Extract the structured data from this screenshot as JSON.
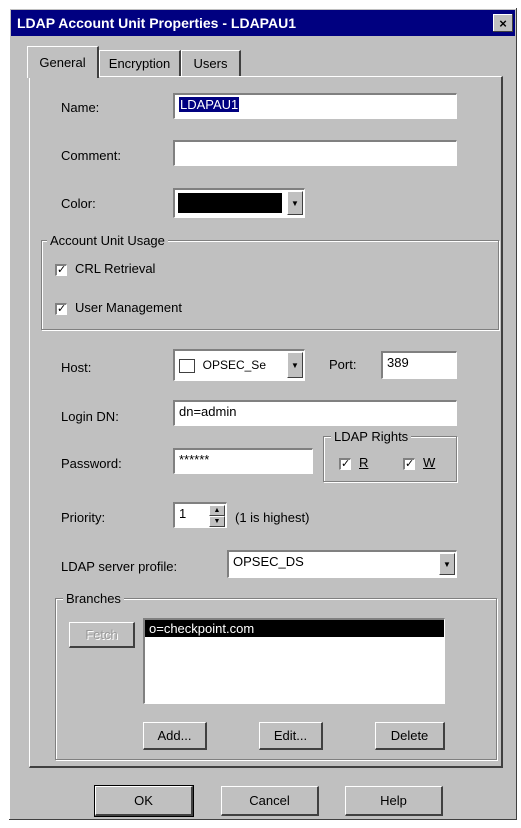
{
  "window": {
    "title": "LDAP Account Unit Properties - LDAPAU1",
    "close_glyph": "×"
  },
  "tabs": [
    {
      "label": "General",
      "active": true
    },
    {
      "label": "Encryption",
      "active": false
    },
    {
      "label": "Users",
      "active": false
    }
  ],
  "general": {
    "name_label": "Name:",
    "name_value": "LDAPAU1",
    "comment_label": "Comment:",
    "comment_value": "",
    "color_label": "Color:",
    "color_value": "#000000"
  },
  "usage": {
    "title": "Account Unit Usage",
    "crl_label": "CRL Retrieval",
    "crl_checked": true,
    "user_mgmt_label": "User Management",
    "user_mgmt_checked": true
  },
  "connection": {
    "host_label": "Host:",
    "host_value": "OPSEC_Se",
    "port_label": "Port:",
    "port_value": "389",
    "login_label": "Login DN:",
    "login_value": "dn=admin",
    "password_label": "Password:",
    "password_value": "******"
  },
  "rights": {
    "title": "LDAP Rights",
    "read_label": "R",
    "read_checked": true,
    "write_label": "W",
    "write_checked": true
  },
  "priority": {
    "label": "Priority:",
    "value": "1",
    "hint": "(1 is highest)"
  },
  "profile": {
    "label": "LDAP server profile:",
    "value": "OPSEC_DS"
  },
  "branches": {
    "title": "Branches",
    "fetch_label": "Fetch",
    "items": [
      "o=checkpoint.com"
    ],
    "add_label": "Add...",
    "edit_label": "Edit...",
    "delete_label": "Delete"
  },
  "footer": {
    "ok_label": "OK",
    "cancel_label": "Cancel",
    "help_label": "Help"
  }
}
